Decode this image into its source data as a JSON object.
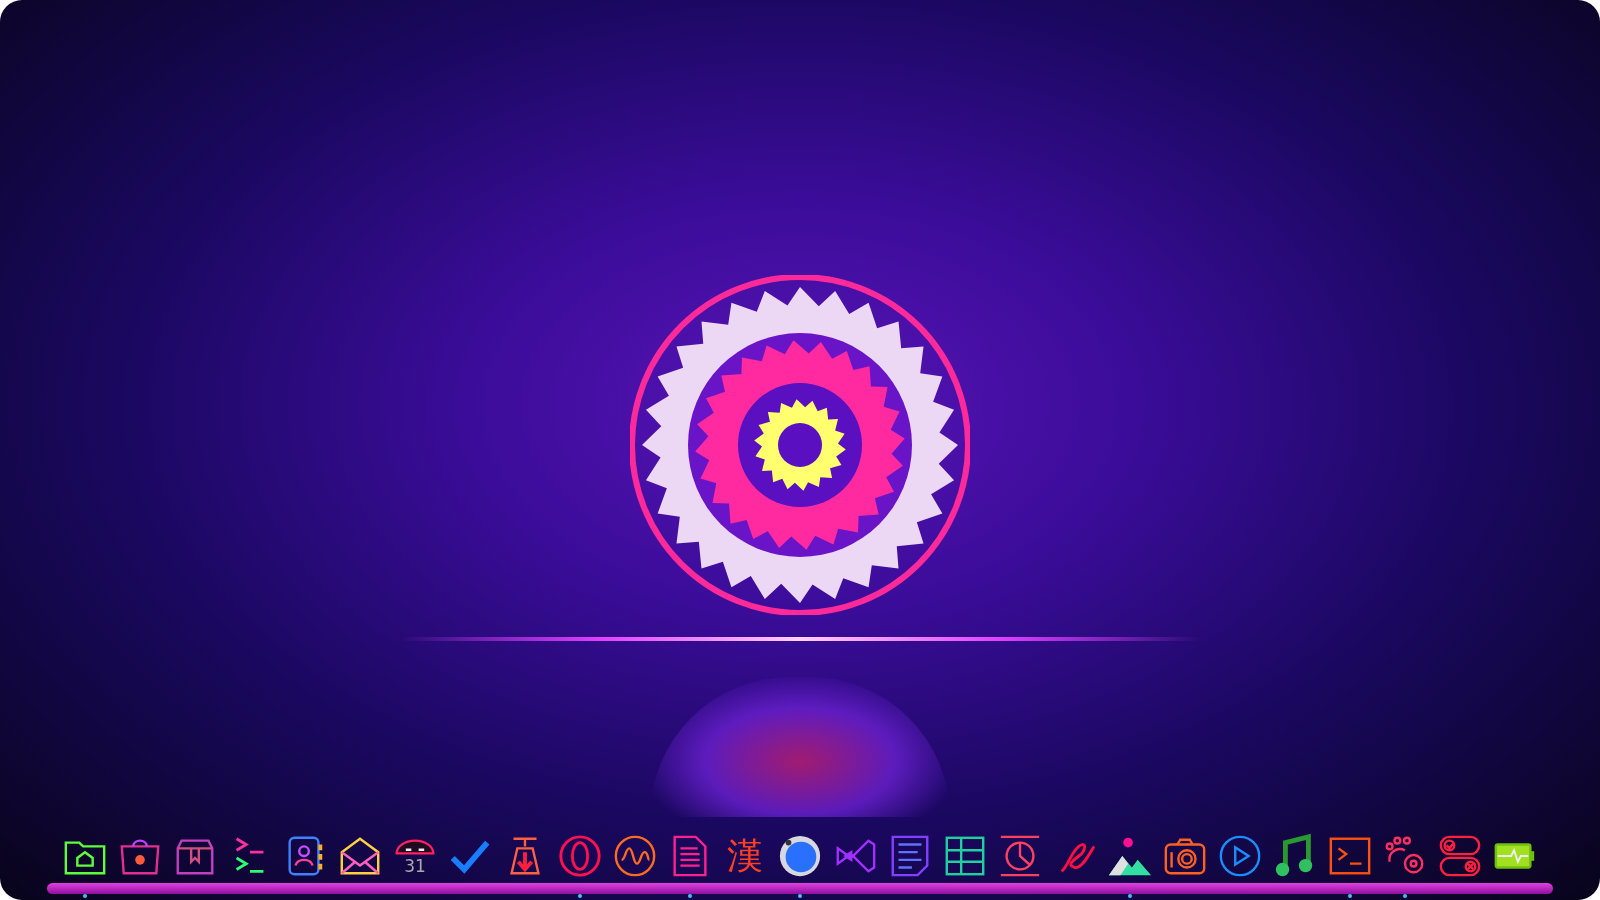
{
  "dock": {
    "items": [
      {
        "kind": "folder",
        "running": true
      },
      {
        "kind": "store",
        "running": false
      },
      {
        "kind": "archive",
        "running": false
      },
      {
        "kind": "prompt",
        "running": false
      },
      {
        "kind": "contacts",
        "running": false
      },
      {
        "kind": "mail",
        "running": false
      },
      {
        "kind": "calendar",
        "text": "31",
        "running": false
      },
      {
        "kind": "check",
        "running": false
      },
      {
        "kind": "download",
        "running": false
      },
      {
        "kind": "ring",
        "running": true
      },
      {
        "kind": "wave",
        "running": false
      },
      {
        "kind": "document",
        "running": true
      },
      {
        "kind": "glyph",
        "text": "漢",
        "running": false
      },
      {
        "kind": "sphere",
        "running": true
      },
      {
        "kind": "code",
        "running": false
      },
      {
        "kind": "notes",
        "running": false
      },
      {
        "kind": "grid",
        "running": false
      },
      {
        "kind": "chart",
        "running": false
      },
      {
        "kind": "pen",
        "running": false
      },
      {
        "kind": "photos",
        "running": true
      },
      {
        "kind": "camera",
        "running": false
      },
      {
        "kind": "play",
        "running": false
      },
      {
        "kind": "music",
        "running": false
      },
      {
        "kind": "terminal",
        "running": true
      },
      {
        "kind": "paw",
        "running": true
      },
      {
        "kind": "toggles",
        "running": false
      },
      {
        "kind": "battery",
        "running": false
      }
    ]
  }
}
